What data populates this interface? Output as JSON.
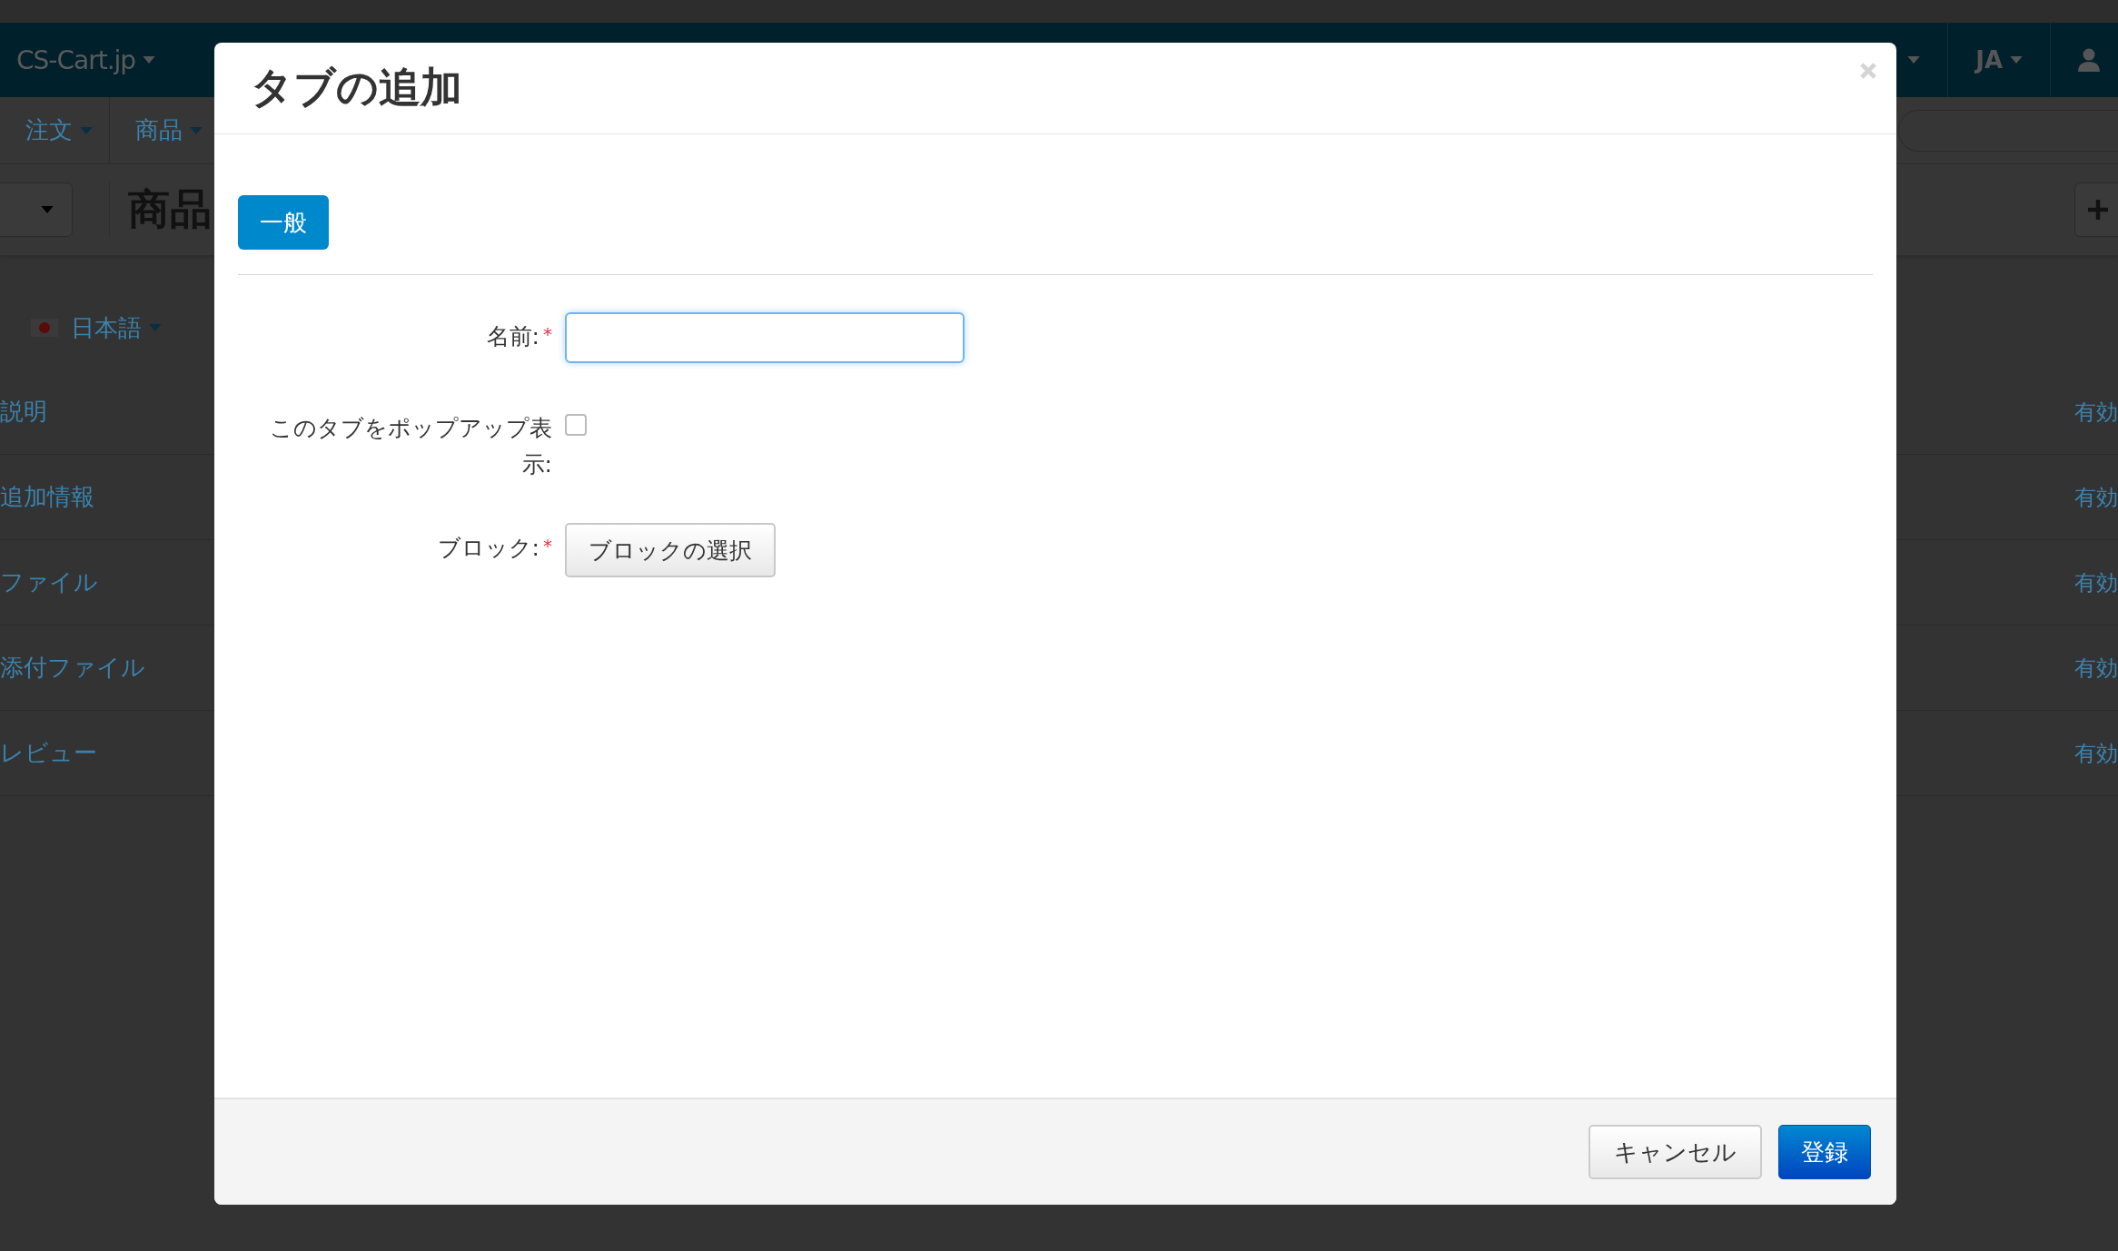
{
  "app": {
    "brand": "CS-Cart.jp",
    "language_menu": "JA",
    "nav": [
      {
        "label": "注文"
      },
      {
        "label": "商品"
      }
    ],
    "page_title": "商品",
    "content_language": "日本語",
    "rows": [
      {
        "name": "説明",
        "status": "有効"
      },
      {
        "name": "追加情報",
        "status": "有効"
      },
      {
        "name": "ファイル",
        "status": "有効"
      },
      {
        "name": "添付ファイル",
        "status": "有効"
      },
      {
        "name": "レビュー",
        "status": "有効"
      }
    ]
  },
  "dialog": {
    "title": "タブの追加",
    "tabs": [
      {
        "label": "一般",
        "selected": true
      }
    ],
    "fields": [
      {
        "kind": "text",
        "label": "名前:",
        "mark": "*",
        "focused": true
      },
      {
        "kind": "checkbox",
        "label": "このタブをポップアップ表示:",
        "checked": false
      },
      {
        "kind": "picker",
        "label": "ブロック:",
        "mark": "*",
        "button": "ブロックの選択"
      }
    ],
    "buttons": [
      {
        "kind": "secondary",
        "label": "キャンセル"
      },
      {
        "kind": "primary",
        "label": "登録"
      }
    ]
  }
}
